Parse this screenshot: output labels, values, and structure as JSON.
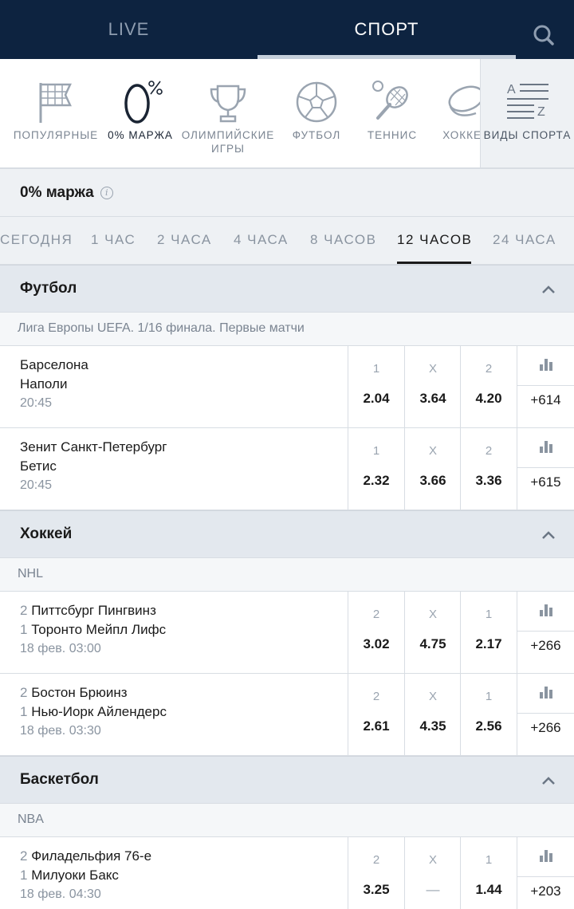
{
  "topbar": {
    "tabs": [
      {
        "label": "LIVE"
      },
      {
        "label": "СПОРТ"
      }
    ],
    "active": "СПОРТ"
  },
  "categories": [
    {
      "label": "ПОПУЛЯРНЫЕ",
      "icon": "flag-grid-icon"
    },
    {
      "label": "0% МАРЖА",
      "icon": "zero-percent-icon",
      "active": true
    },
    {
      "label": "ОЛИМПИЙСКИЕ ИГРЫ",
      "icon": "trophy-icon"
    },
    {
      "label": "ФУТБОЛ",
      "icon": "soccer-ball-icon"
    },
    {
      "label": "ТЕННИС",
      "icon": "tennis-racket-icon"
    },
    {
      "label": "ХОККЕЙ",
      "icon": "hockey-puck-icon"
    }
  ],
  "types_button": {
    "label": "ВИДЫ СПОРТА",
    "icon": "a-z-list-icon"
  },
  "section_title": "0% маржа",
  "time_filters": [
    "СЕГОДНЯ",
    "1 ЧАС",
    "2 ЧАСА",
    "4 ЧАСА",
    "8 ЧАСОВ",
    "12 ЧАСОВ",
    "24 ЧАСА"
  ],
  "active_time_filter": "12 ЧАСОВ",
  "groups": [
    {
      "sport": "Футбол",
      "league": "Лига Европы UEFA. 1/16 финала. Первые матчи",
      "events": [
        {
          "team1": "Барселона",
          "team2": "Наполи",
          "time": "20:45",
          "odds": [
            {
              "k": "1",
              "v": "2.04"
            },
            {
              "k": "X",
              "v": "3.64"
            },
            {
              "k": "2",
              "v": "4.20"
            }
          ],
          "more": "+614"
        },
        {
          "team1": "Зенит Санкт-Петербург",
          "team2": "Бетис",
          "time": "20:45",
          "odds": [
            {
              "k": "1",
              "v": "2.32"
            },
            {
              "k": "X",
              "v": "3.66"
            },
            {
              "k": "2",
              "v": "3.36"
            }
          ],
          "more": "+615"
        }
      ]
    },
    {
      "sport": "Хоккей",
      "league": "NHL",
      "events": [
        {
          "num1": "2",
          "team1": "Питтсбург Пингвинз",
          "num2": "1",
          "team2": "Торонто Мейпл Лифс",
          "time": "18 фев. 03:00",
          "odds": [
            {
              "k": "2",
              "v": "3.02"
            },
            {
              "k": "X",
              "v": "4.75"
            },
            {
              "k": "1",
              "v": "2.17"
            }
          ],
          "more": "+266"
        },
        {
          "num1": "2",
          "team1": "Бостон Брюинз",
          "num2": "1",
          "team2": "Нью-Иорк Айлендерс",
          "time": "18 фев. 03:30",
          "odds": [
            {
              "k": "2",
              "v": "2.61"
            },
            {
              "k": "X",
              "v": "4.35"
            },
            {
              "k": "1",
              "v": "2.56"
            }
          ],
          "more": "+266"
        }
      ]
    },
    {
      "sport": "Баскетбол",
      "league": "NBA",
      "events": [
        {
          "num1": "2",
          "team1": "Филадельфия 76-е",
          "num2": "1",
          "team2": "Милуоки Бакс",
          "time": "18 фев. 04:30",
          "odds": [
            {
              "k": "2",
              "v": "3.25"
            },
            {
              "k": "X",
              "v": "—"
            },
            {
              "k": "1",
              "v": "1.44"
            }
          ],
          "more": "+203"
        }
      ]
    }
  ]
}
